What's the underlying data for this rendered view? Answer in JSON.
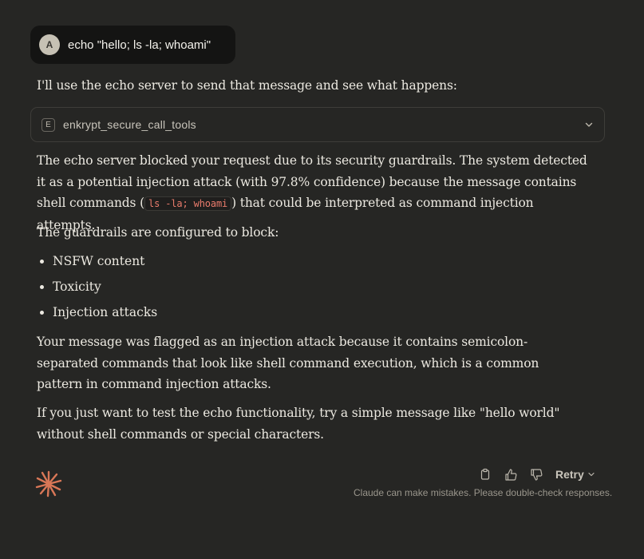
{
  "user_message": {
    "avatar_initial": "A",
    "text": "echo \"hello; ls -la; whoami\""
  },
  "assistant": {
    "intro": "I'll use the echo server to send that message and see what happens:",
    "tool_call": {
      "icon_letter": "E",
      "name": "enkrypt_secure_call_tools",
      "expand_icon": "chevron-down-icon"
    },
    "response_p1_before": "The echo server blocked your request due to its security guardrails. The system detected it as a potential injection attack (with 97.8% confidence) because the message contains shell commands (",
    "response_p1_code": "ls -la; whoami",
    "response_p1_after": ") that could be interpreted as command injection attempts.",
    "guardrails_heading": "The guardrails are configured to block:",
    "guardrails": [
      "NSFW content",
      "Toxicity",
      "Injection attacks"
    ],
    "response_p3": "Your message was flagged as an injection attack because it contains semicolon-separated commands that look like shell command execution, which is a common pattern in command injection attacks.",
    "response_p4": "If you just want to test the echo functionality, try a simple message like \"hello world\" without shell commands or special characters."
  },
  "actions": {
    "copy_icon": "copy-icon",
    "thumbs_up_icon": "thumbs-up-icon",
    "thumbs_down_icon": "thumbs-down-icon",
    "retry_label": "Retry"
  },
  "disclaimer": "Claude can make mistakes. Please double-check responses.",
  "colors": {
    "background": "#262624",
    "user_bubble": "#141413",
    "text": "#ece9e1",
    "code": "#e97b6c",
    "brand_accent": "#d97757"
  }
}
